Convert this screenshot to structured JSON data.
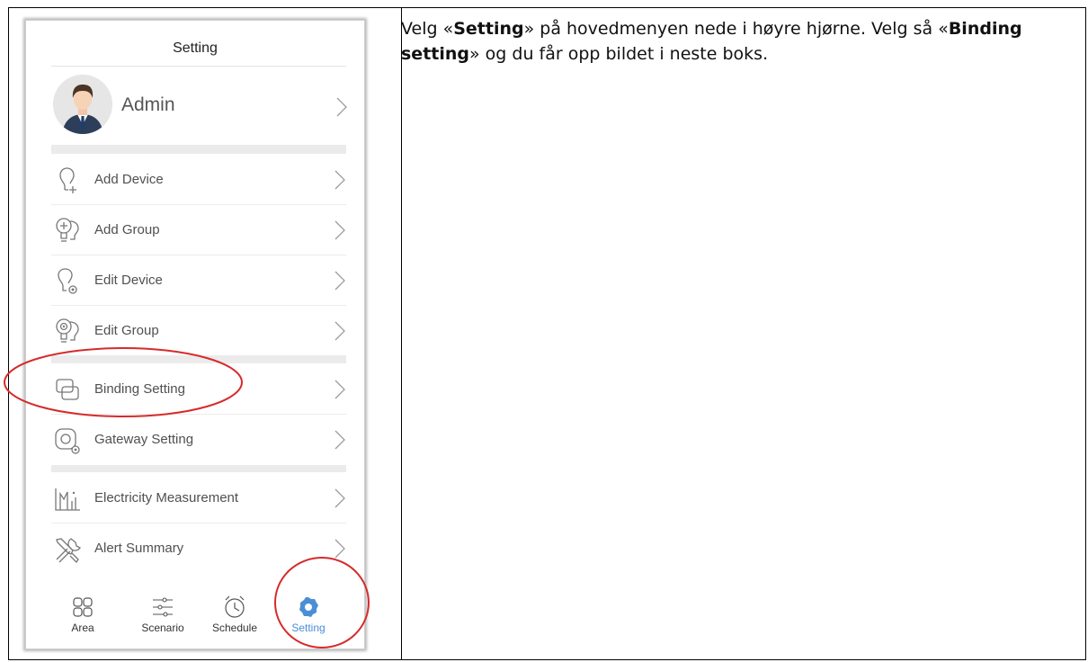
{
  "phone": {
    "title": "Setting",
    "profile": {
      "name": "Admin",
      "avatar_icon": "avatar-icon"
    },
    "menu": [
      {
        "label": "Add Device",
        "icon": "bulb-plus-icon"
      },
      {
        "label": "Add Group",
        "icon": "bulbs-plus-icon"
      },
      {
        "label": "Edit Device",
        "icon": "bulb-gear-icon"
      },
      {
        "label": "Edit Group",
        "icon": "bulbs-gear-icon"
      },
      {
        "label": "Binding Setting",
        "icon": "binding-icon"
      },
      {
        "label": "Gateway Setting",
        "icon": "gateway-icon"
      },
      {
        "label": "Electricity Measurement",
        "icon": "chart-icon"
      },
      {
        "label": "Alert Summary",
        "icon": "tools-icon"
      }
    ],
    "tabs": [
      {
        "label": "Area",
        "icon": "grid-icon"
      },
      {
        "label": "Scenario",
        "icon": "sliders-icon"
      },
      {
        "label": "Schedule",
        "icon": "alarm-clock-icon"
      },
      {
        "label": "Setting",
        "icon": "gear-icon"
      }
    ],
    "active_tab": "Setting",
    "accent_color": "#4a8fd6",
    "annotation_color": "#d62b2b"
  },
  "instruction": {
    "p1": "Velg «",
    "b1": "Setting",
    "p2": "» på hovedmenyen nede i høyre hjørne. Velg så «",
    "b2": "Binding setting",
    "p3": "» og du får opp bildet i neste boks."
  }
}
